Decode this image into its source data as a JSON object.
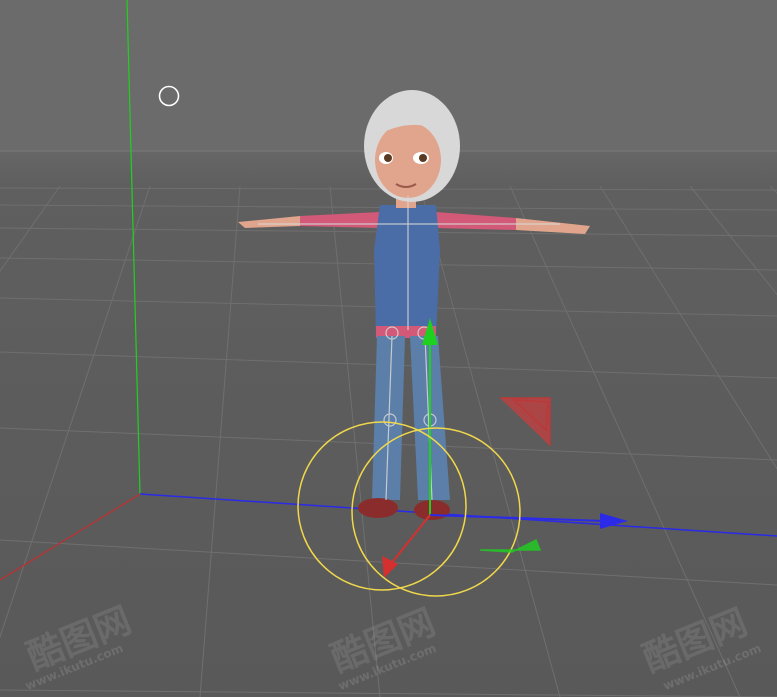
{
  "viewport": {
    "background": "#6b6b6b",
    "axis_x_color": "#2a2ae8",
    "axis_y_color": "#1fd11f",
    "axis_z_color": "#d43030",
    "grid_color": "#757575",
    "selection_color": "#f0d84a"
  },
  "character": {
    "hair_color": "#d8d8d8",
    "skin_color": "#e0a58c",
    "vest_color": "#4a6da8",
    "shirt_color": "#d25a78",
    "jeans_color": "#5b7fa8"
  },
  "watermark": {
    "brand": "酷图网",
    "url": "www.ikutu.com"
  }
}
